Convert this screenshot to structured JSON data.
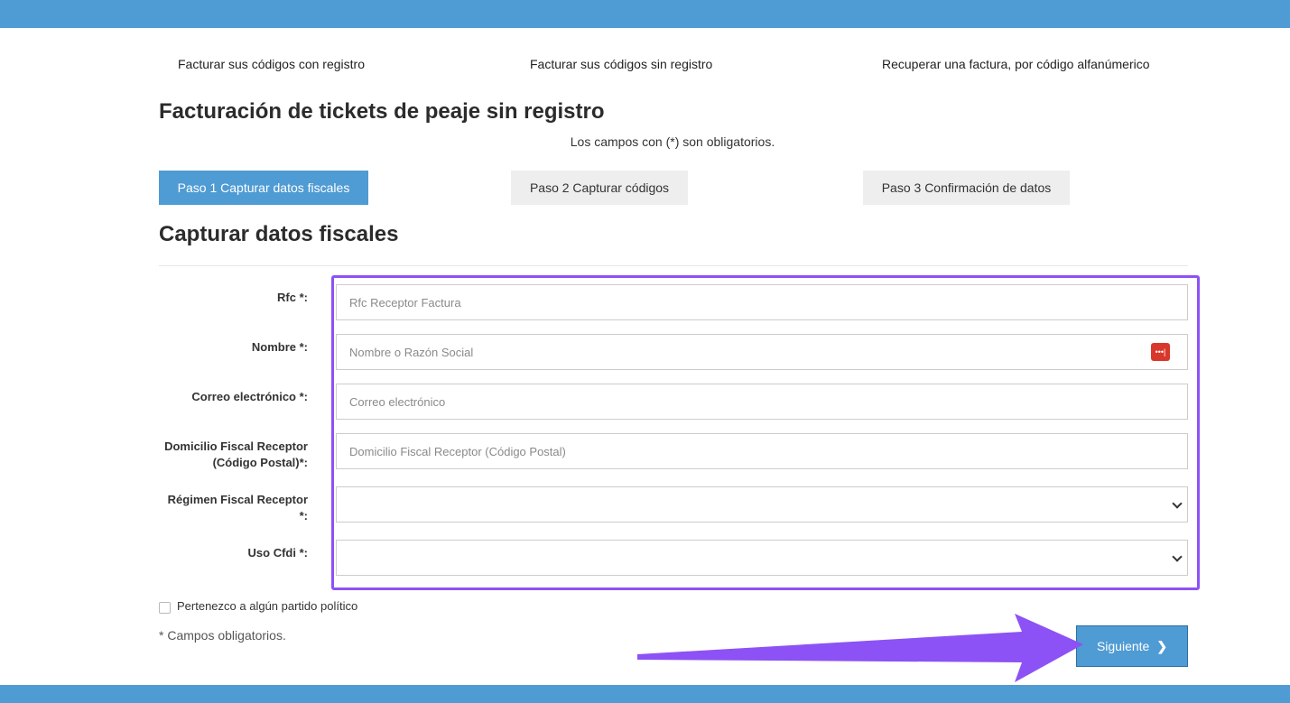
{
  "nav": {
    "links": [
      "Facturar sus códigos con registro",
      "Facturar sus códigos sin registro",
      "Recuperar una factura, por código alfanúmerico"
    ]
  },
  "page": {
    "title": "Facturación de tickets de peaje sin registro",
    "required_note": "Los campos con (*) son obligatorios."
  },
  "steps": [
    "Paso 1 Capturar datos fiscales",
    "Paso 2 Capturar códigos",
    "Paso 3 Confirmación de datos"
  ],
  "section": {
    "title": "Capturar datos fiscales"
  },
  "form": {
    "rfc": {
      "label": "Rfc *:",
      "placeholder": "Rfc Receptor Factura"
    },
    "nombre": {
      "label": "Nombre *:",
      "placeholder": "Nombre o Razón Social",
      "autofill_icon": "password-manager-icon"
    },
    "correo": {
      "label": "Correo electrónico *:",
      "placeholder": "Correo electrónico"
    },
    "domicilio": {
      "label_line1": "Domicilio Fiscal Receptor",
      "label_line2": "(Código Postal)*:",
      "placeholder": "Domicilio Fiscal Receptor (Código Postal)"
    },
    "regimen": {
      "label_line1": "Régimen Fiscal Receptor",
      "label_line2": "*:",
      "value": ""
    },
    "uso_cfdi": {
      "label": "Uso Cfdi *:",
      "value": ""
    },
    "partido_checkbox": {
      "label": "Pertenezco a algún partido político",
      "checked": false
    },
    "footnote": "* Campos obligatorios.",
    "next_button": "Siguiente"
  },
  "colors": {
    "brand_blue": "#4f9bd4",
    "annotation_purple": "#8c52f5",
    "autofill_red": "#d9372c"
  }
}
